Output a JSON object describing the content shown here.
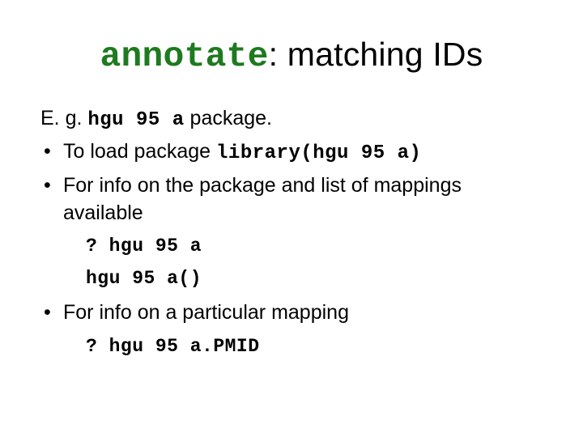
{
  "title": {
    "code_part": "annotate",
    "rest": ": matching IDs"
  },
  "intro": {
    "prefix": "E. g. ",
    "code": "hgu 95 a",
    "suffix": " package."
  },
  "bullets": [
    {
      "text_before": "To load package ",
      "code": "library(hgu 95 a)",
      "text_after": "",
      "subs": []
    },
    {
      "text_before": "For info on the package and list of mappings available",
      "code": "",
      "text_after": "",
      "subs": [
        {
          "code": "? hgu 95 a"
        },
        {
          "code": "hgu 95 a()"
        }
      ]
    },
    {
      "text_before": "For info on a particular mapping",
      "code": "",
      "text_after": "",
      "subs": [
        {
          "code": "? hgu 95 a.PMID"
        }
      ]
    }
  ]
}
